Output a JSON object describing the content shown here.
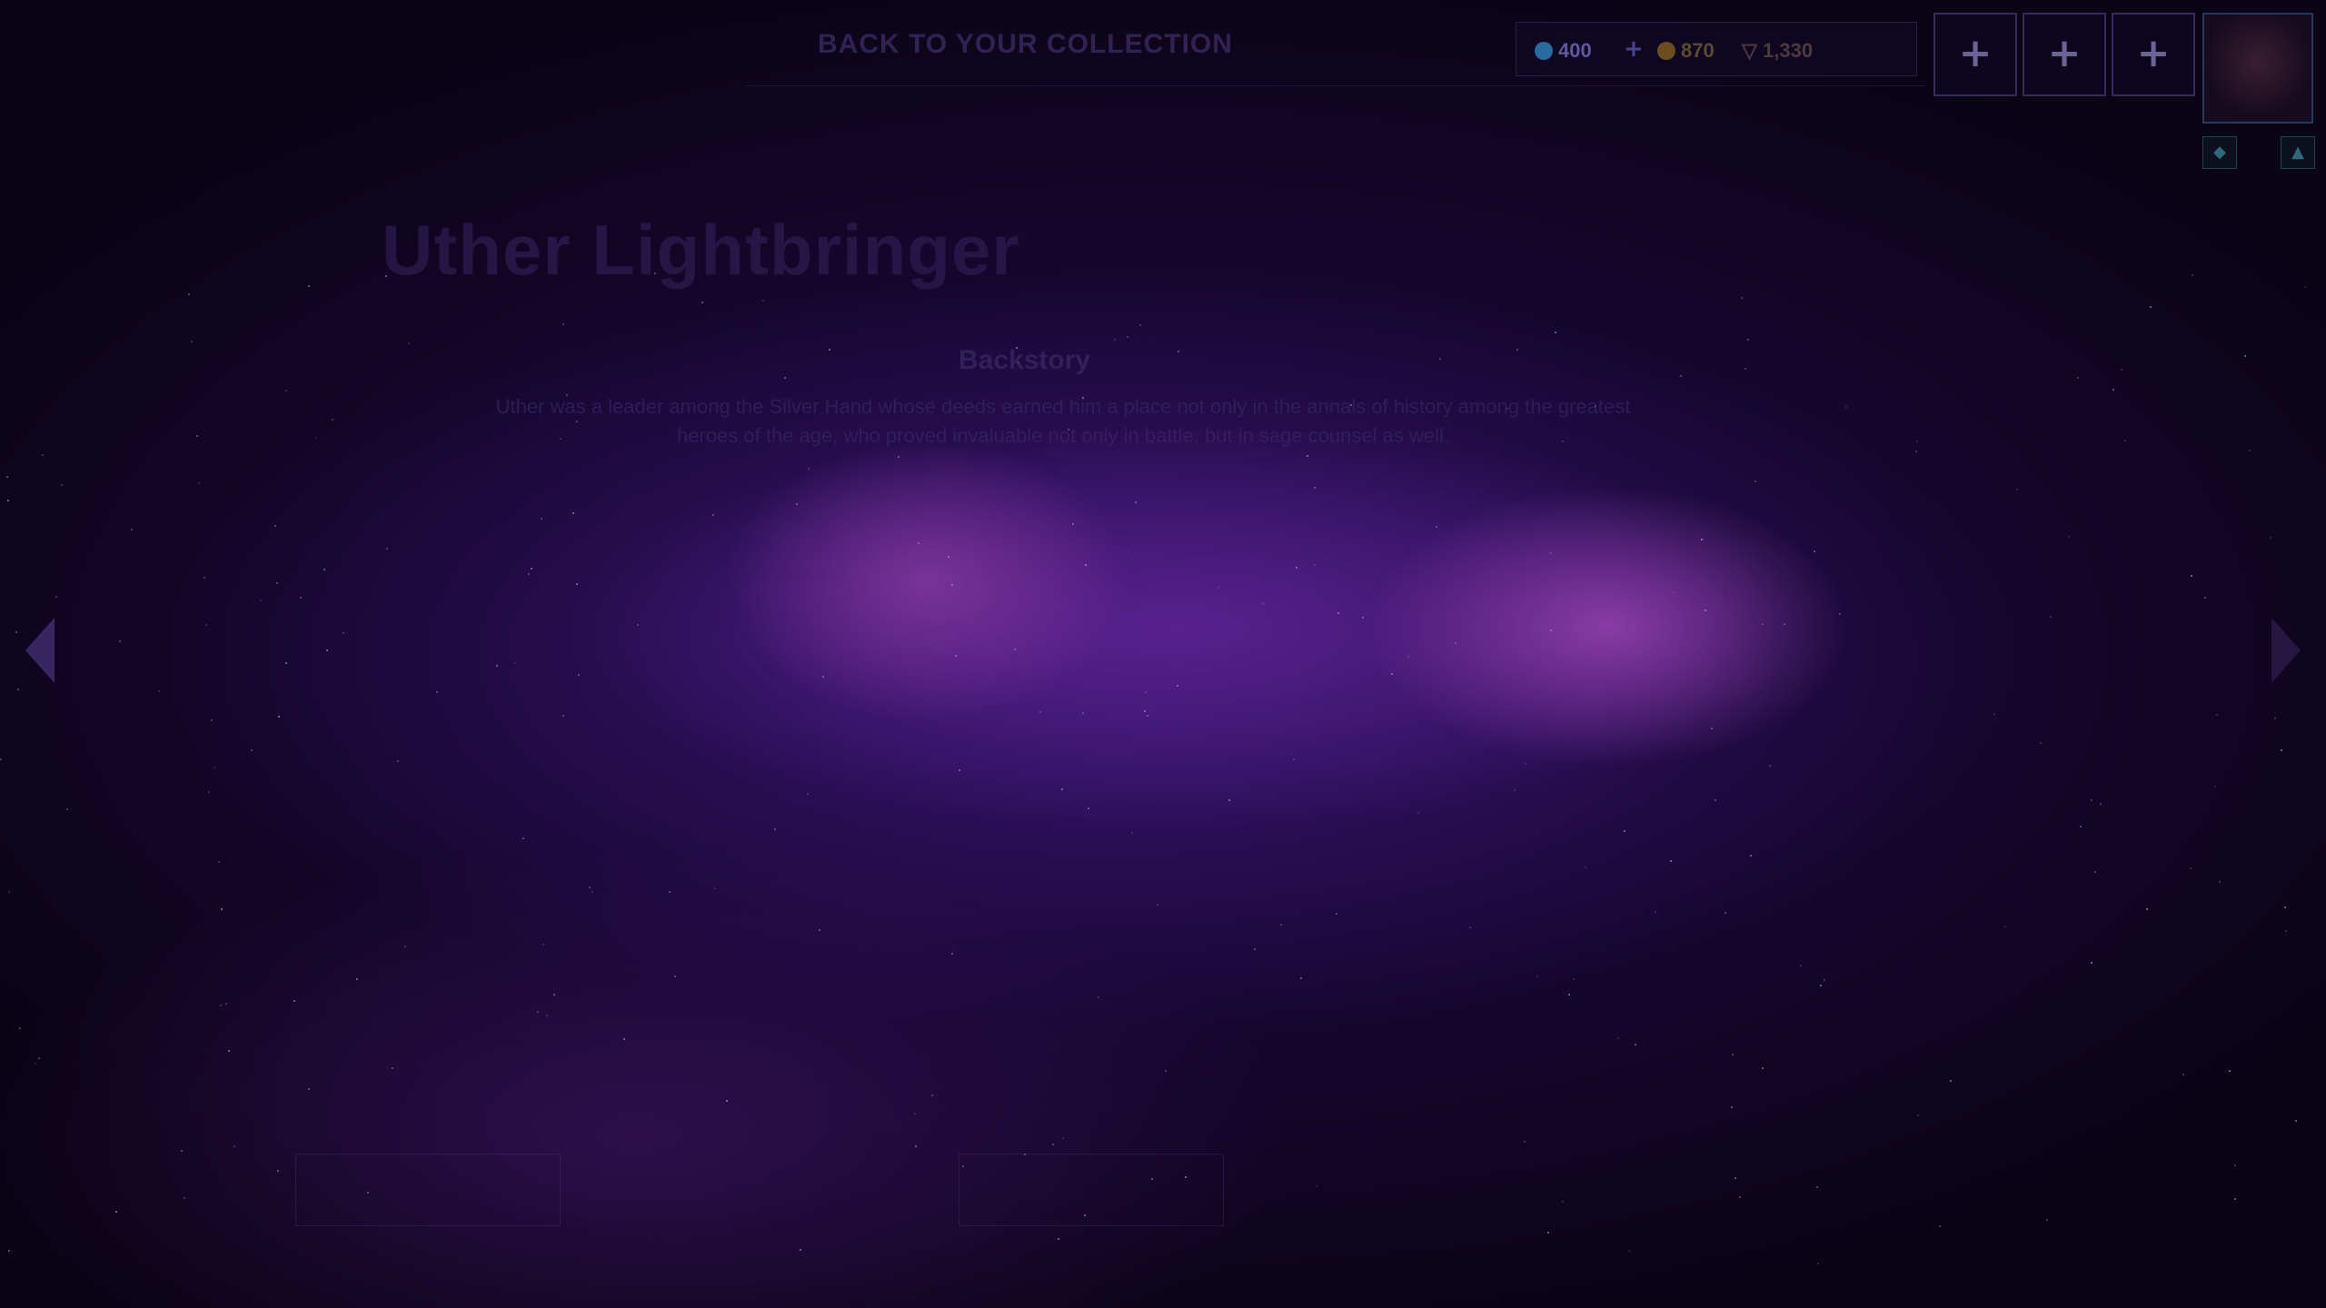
{
  "topbar": {
    "back_label": "BACK TO YOUR COLLECTION",
    "gems": "400",
    "add_gems": "+",
    "gold": "870",
    "shards": "1,330",
    "slot_plus": "+"
  },
  "hero": {
    "name": "Uther Lightbringer",
    "backstory_title": "Backstory",
    "backstory_text": "Uther was a leader among the Silver Hand whose deeds earned him a place not only in the annals of history among the greatest heroes of the age, who proved invaluable not only in battle, but in sage counsel as well."
  },
  "colors": {
    "background": "#0c0418",
    "nebula_highlight": "#b950d7",
    "nebula_mid": "#782db9"
  }
}
